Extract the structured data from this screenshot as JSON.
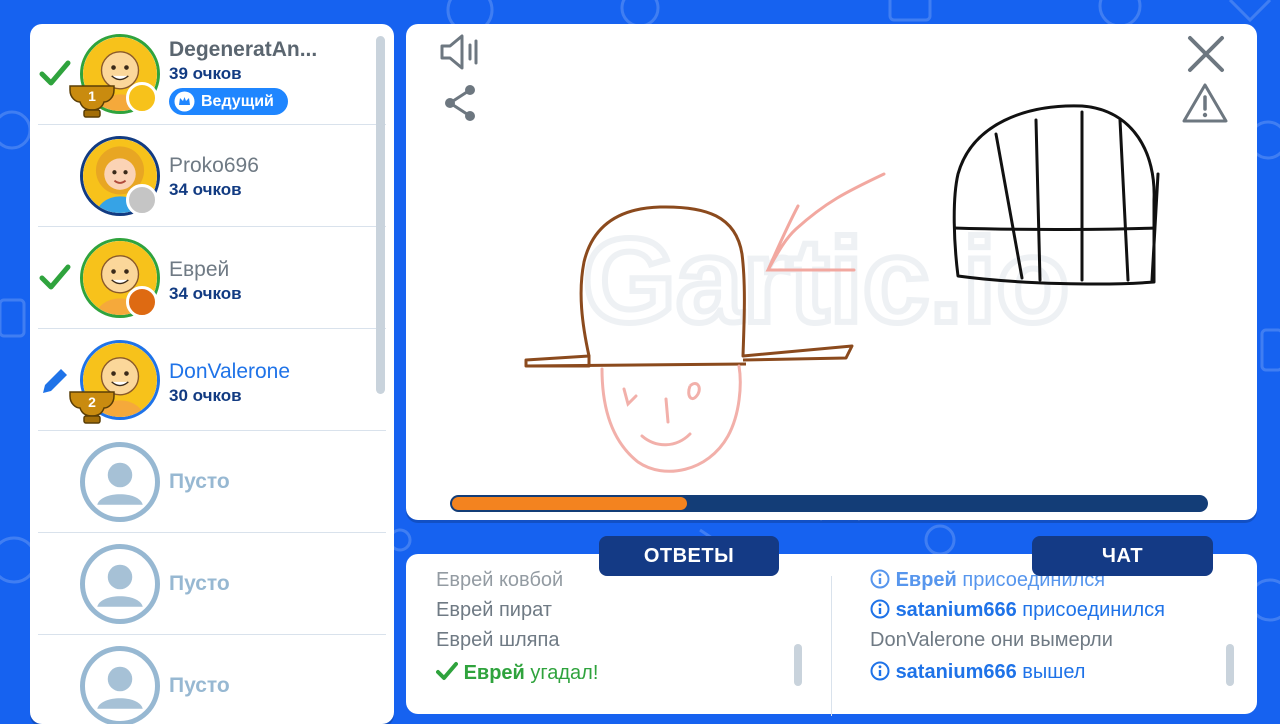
{
  "colors": {
    "background": "#1662f0",
    "primary_text": "#123b82",
    "accent_blue": "#1f73e8",
    "progress_fill": "#f3831f",
    "progress_track": "#133d77",
    "correct_green": "#2fa33d"
  },
  "players": [
    {
      "name": "DegeneratAn...",
      "score": "39 очков",
      "badge": "Ведущий",
      "rank": "1",
      "status": "check-icon",
      "dot_color": "#f7c21b"
    },
    {
      "name": "Proko696",
      "score": "34 очков",
      "status": "",
      "dot_color": "#c5c5c5"
    },
    {
      "name": "Еврей",
      "score": "34 очков",
      "status": "check-icon",
      "dot_color": "#de6a12"
    },
    {
      "name": "DonValerone",
      "score": "30 очков",
      "rank": "2",
      "status": "pencil-icon",
      "dot_color": ""
    }
  ],
  "empty_slot_label": "Пусто",
  "canvas": {
    "watermark": "Gartic.io",
    "progress": 0.31
  },
  "tabs": {
    "answers": "ОТВЕТЫ",
    "chat": "ЧАТ"
  },
  "answers": [
    {
      "user": "Еврей",
      "text": "ковбой"
    },
    {
      "user": "Еврей",
      "text": "пират"
    },
    {
      "user": "Еврей",
      "text": "шляпа"
    },
    {
      "user": "Еврей",
      "text": "угадал!",
      "correct": true
    }
  ],
  "chat": [
    {
      "user": "Еврей",
      "text": "присоединился",
      "info": true
    },
    {
      "user": "satanium666",
      "text": "присоединился",
      "info": true
    },
    {
      "user": "DonValerone",
      "text": "они вымерли"
    },
    {
      "user": "satanium666",
      "text": "вышел",
      "info": true
    }
  ]
}
